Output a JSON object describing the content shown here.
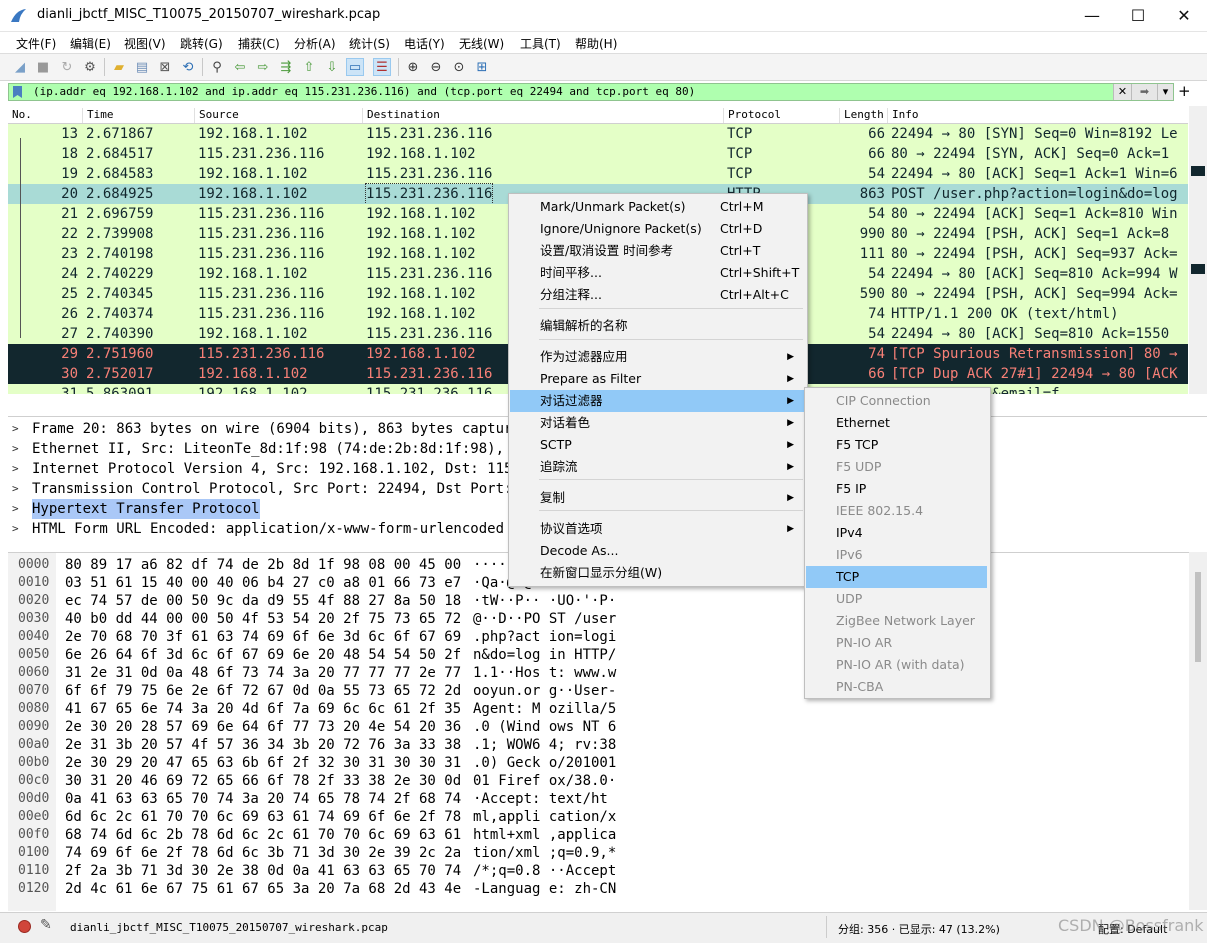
{
  "window": {
    "title": "dianli_jbctf_MISC_T10075_20150707_wireshark.pcap",
    "minimize": "—",
    "maximize": "☐",
    "close": "✕"
  },
  "menu": [
    "文件(F)",
    "编辑(E)",
    "视图(V)",
    "跳转(G)",
    "捕获(C)",
    "分析(A)",
    "统计(S)",
    "电话(Y)",
    "无线(W)",
    "工具(T)",
    "帮助(H)"
  ],
  "filter": {
    "text": "(ip.addr eq 192.168.1.102 and ip.addr eq 115.231.236.116) and (tcp.port eq 22494 and tcp.port eq 80)",
    "clear": "✕",
    "apply": "➡",
    "dropdown": "▾",
    "add": "+"
  },
  "columns": [
    "No.",
    "Time",
    "Source",
    "Destination",
    "Protocol",
    "Length",
    "Info"
  ],
  "packets": [
    {
      "no": "13",
      "time": "2.671867",
      "src": "192.168.1.102",
      "dst": "115.231.236.116",
      "proto": "TCP",
      "len": "66",
      "info": "22494 → 80 [SYN] Seq=0 Win=8192 Le"
    },
    {
      "no": "18",
      "time": "2.684517",
      "src": "115.231.236.116",
      "dst": "192.168.1.102",
      "proto": "TCP",
      "len": "66",
      "info": "80 → 22494 [SYN, ACK] Seq=0 Ack=1"
    },
    {
      "no": "19",
      "time": "2.684583",
      "src": "192.168.1.102",
      "dst": "115.231.236.116",
      "proto": "TCP",
      "len": "54",
      "info": "22494 → 80 [ACK] Seq=1 Ack=1 Win=6"
    },
    {
      "no": "20",
      "time": "2.684925",
      "src": "192.168.1.102",
      "dst": "115.231.236.116",
      "proto": "HTTP",
      "len": "863",
      "info": "POST /user.php?action=login&do=log"
    },
    {
      "no": "21",
      "time": "2.696759",
      "src": "115.231.236.116",
      "dst": "192.168.1.102",
      "proto": "TCP",
      "len": "54",
      "info": "80 → 22494 [ACK] Seq=1 Ack=810 Win"
    },
    {
      "no": "22",
      "time": "2.739908",
      "src": "115.231.236.116",
      "dst": "192.168.1.102",
      "proto": "TCP",
      "len": "990",
      "info": "80 → 22494 [PSH, ACK] Seq=1 Ack=8"
    },
    {
      "no": "23",
      "time": "2.740198",
      "src": "115.231.236.116",
      "dst": "192.168.1.102",
      "proto": "TCP",
      "len": "111",
      "info": "80 → 22494 [PSH, ACK] Seq=937 Ack="
    },
    {
      "no": "24",
      "time": "2.740229",
      "src": "192.168.1.102",
      "dst": "115.231.236.116",
      "proto": "TCP",
      "len": "54",
      "info": "22494 → 80 [ACK] Seq=810 Ack=994 W"
    },
    {
      "no": "25",
      "time": "2.740345",
      "src": "115.231.236.116",
      "dst": "192.168.1.102",
      "proto": "TCP",
      "len": "590",
      "info": "80 → 22494 [PSH, ACK] Seq=994 Ack="
    },
    {
      "no": "26",
      "time": "2.740374",
      "src": "115.231.236.116",
      "dst": "192.168.1.102",
      "proto": "HTTP",
      "len": "74",
      "info": "HTTP/1.1 200 OK  (text/html)"
    },
    {
      "no": "27",
      "time": "2.740390",
      "src": "192.168.1.102",
      "dst": "115.231.236.116",
      "proto": "TCP",
      "len": "54",
      "info": "22494 → 80 [ACK] Seq=810 Ack=1550"
    },
    {
      "no": "29",
      "time": "2.751960",
      "src": "115.231.236.116",
      "dst": "192.168.1.102",
      "proto": "TCP",
      "len": "74",
      "info": "[TCP Spurious Retransmission] 80 →"
    },
    {
      "no": "30",
      "time": "2.752017",
      "src": "192.168.1.102",
      "dst": "115.231.236.116",
      "proto": "TCP",
      "len": "66",
      "info": "[TCP Dup ACK 27#1] 22494 → 80 [ACK"
    },
    {
      "no": "31",
      "time": "5.863091",
      "src": "192.168.1.102",
      "dst": "115.231.236.116",
      "proto": "HTTP",
      "len": "",
      "info": "action=login&email=f"
    }
  ],
  "details": [
    {
      "text": "Frame 20: 863 bytes on wire (6904 bits), 863 bytes captured"
    },
    {
      "text": "Ethernet II, Src: LiteonTe_8d:1f:98 (74:de:2b:8d:1f:98), Ds"
    },
    {
      "text": "Internet Protocol Version 4, Src: 192.168.1.102, Dst: 115.2"
    },
    {
      "text": "Transmission Control Protocol, Src Port: 22494, Dst Port: 8"
    },
    {
      "text": "Hypertext Transfer Protocol"
    },
    {
      "text": "HTML Form URL Encoded: application/x-www-form-urlencoded"
    }
  ],
  "hex": [
    {
      "off": "0000",
      "bytes": "80 89 17 a6 82 df 74 de  2b 8d 1f 98 08 00 45 00",
      "ascii": "······t· +·····E·"
    },
    {
      "off": "0010",
      "bytes": "03 51 61 15 40 00 40 06  b4 27 c0 a8 01 66 73 e7",
      "ascii": "·Qa·@·@· ·'···fs·"
    },
    {
      "off": "0020",
      "bytes": "ec 74 57 de 00 50 9c da  d9 55 4f 88 27 8a 50 18",
      "ascii": "·tW··P·· ·UO·'·P·"
    },
    {
      "off": "0030",
      "bytes": "40 b0 dd 44 00 00 50 4f  53 54 20 2f 75 73 65 72",
      "ascii": "@··D··PO ST /user"
    },
    {
      "off": "0040",
      "bytes": "2e 70 68 70 3f 61 63 74  69 6f 6e 3d 6c 6f 67 69",
      "ascii": ".php?act ion=logi"
    },
    {
      "off": "0050",
      "bytes": "6e 26 64 6f 3d 6c 6f 67  69 6e 20 48 54 54 50 2f",
      "ascii": "n&do=log in HTTP/"
    },
    {
      "off": "0060",
      "bytes": "31 2e 31 0d 0a 48 6f 73  74 3a 20 77 77 77 2e 77",
      "ascii": "1.1··Hos t: www.w"
    },
    {
      "off": "0070",
      "bytes": "6f 6f 79 75 6e 2e 6f 72  67 0d 0a 55 73 65 72 2d",
      "ascii": "ooyun.or g··User-"
    },
    {
      "off": "0080",
      "bytes": "41 67 65 6e 74 3a 20 4d  6f 7a 69 6c 6c 61 2f 35",
      "ascii": "Agent: M ozilla/5"
    },
    {
      "off": "0090",
      "bytes": "2e 30 20 28 57 69 6e 64  6f 77 73 20 4e 54 20 36",
      "ascii": ".0 (Wind ows NT 6"
    },
    {
      "off": "00a0",
      "bytes": "2e 31 3b 20 57 4f 57 36  34 3b 20 72 76 3a 33 38",
      "ascii": ".1; WOW6 4; rv:38"
    },
    {
      "off": "00b0",
      "bytes": "2e 30 29 20 47 65 63 6b  6f 2f 32 30 31 30 30 31",
      "ascii": ".0) Geck o/201001"
    },
    {
      "off": "00c0",
      "bytes": "30 31 20 46 69 72 65 66  6f 78 2f 33 38 2e 30 0d",
      "ascii": "01 Firef ox/38.0·"
    },
    {
      "off": "00d0",
      "bytes": "0a 41 63 63 65 70 74 3a  20 74 65 78 74 2f 68 74",
      "ascii": "·Accept:  text/ht"
    },
    {
      "off": "00e0",
      "bytes": "6d 6c 2c 61 70 70 6c 69  63 61 74 69 6f 6e 2f 78",
      "ascii": "ml,appli cation/x"
    },
    {
      "off": "00f0",
      "bytes": "68 74 6d 6c 2b 78 6d 6c  2c 61 70 70 6c 69 63 61",
      "ascii": "html+xml ,applica"
    },
    {
      "off": "0100",
      "bytes": "74 69 6f 6e 2f 78 6d 6c  3b 71 3d 30 2e 39 2c 2a",
      "ascii": "tion/xml ;q=0.9,*"
    },
    {
      "off": "0110",
      "bytes": "2f 2a 3b 71 3d 30 2e 38  0d 0a 41 63 63 65 70 74",
      "ascii": "/*;q=0.8 ··Accept"
    },
    {
      "off": "0120",
      "bytes": "2d 4c 61 6e 67 75 61 67  65 3a 20 7a 68 2d 43 4e",
      "ascii": "-Languag e: zh-CN"
    }
  ],
  "status": {
    "file": "dianli_jbctf_MISC_T10075_20150707_wireshark.pcap",
    "packets": "分组: 356 · 已显示: 47 (13.2%)",
    "profile": "配置: Default",
    "watermark": "CSDN @Bossfrank"
  },
  "context_menu": [
    {
      "label": "Mark/Unmark Packet(s)",
      "shortcut": "Ctrl+M"
    },
    {
      "label": "Ignore/Unignore Packet(s)",
      "shortcut": "Ctrl+D"
    },
    {
      "label": "设置/取消设置 时间参考",
      "shortcut": "Ctrl+T"
    },
    {
      "label": "时间平移...",
      "shortcut": "Ctrl+Shift+T"
    },
    {
      "label": "分组注释...",
      "shortcut": "Ctrl+Alt+C"
    },
    {
      "label": "编辑解析的名称",
      "shortcut": ""
    },
    {
      "label": "作为过滤器应用",
      "shortcut": ""
    },
    {
      "label": "Prepare as Filter",
      "shortcut": ""
    },
    {
      "label": "对话过滤器",
      "shortcut": ""
    },
    {
      "label": "对话着色",
      "shortcut": ""
    },
    {
      "label": "SCTP",
      "shortcut": ""
    },
    {
      "label": "追踪流",
      "shortcut": ""
    },
    {
      "label": "复制",
      "shortcut": ""
    },
    {
      "label": "协议首选项",
      "shortcut": ""
    },
    {
      "label": "Decode As...",
      "shortcut": ""
    },
    {
      "label": "在新窗口显示分组(W)",
      "shortcut": ""
    }
  ],
  "submenu": [
    {
      "label": "CIP Connection",
      "enabled": false
    },
    {
      "label": "Ethernet",
      "enabled": true
    },
    {
      "label": "F5 TCP",
      "enabled": true
    },
    {
      "label": "F5 UDP",
      "enabled": false
    },
    {
      "label": "F5 IP",
      "enabled": true
    },
    {
      "label": "IEEE 802.15.4",
      "enabled": false
    },
    {
      "label": "IPv4",
      "enabled": true
    },
    {
      "label": "IPv6",
      "enabled": false
    },
    {
      "label": "TCP",
      "enabled": true
    },
    {
      "label": "UDP",
      "enabled": false
    },
    {
      "label": "ZigBee Network Layer",
      "enabled": false
    },
    {
      "label": "PN-IO AR",
      "enabled": false
    },
    {
      "label": "PN-IO AR (with data)",
      "enabled": false
    },
    {
      "label": "PN-CBA",
      "enabled": false
    }
  ],
  "colors": {
    "tcp_row": "#e4ffc7",
    "selected_row": "#a9dbd6",
    "bad_row": "#12272e",
    "bad_text": "#f78077",
    "filter_ok": "#afffaf",
    "menu_hot": "#91c9f7"
  }
}
